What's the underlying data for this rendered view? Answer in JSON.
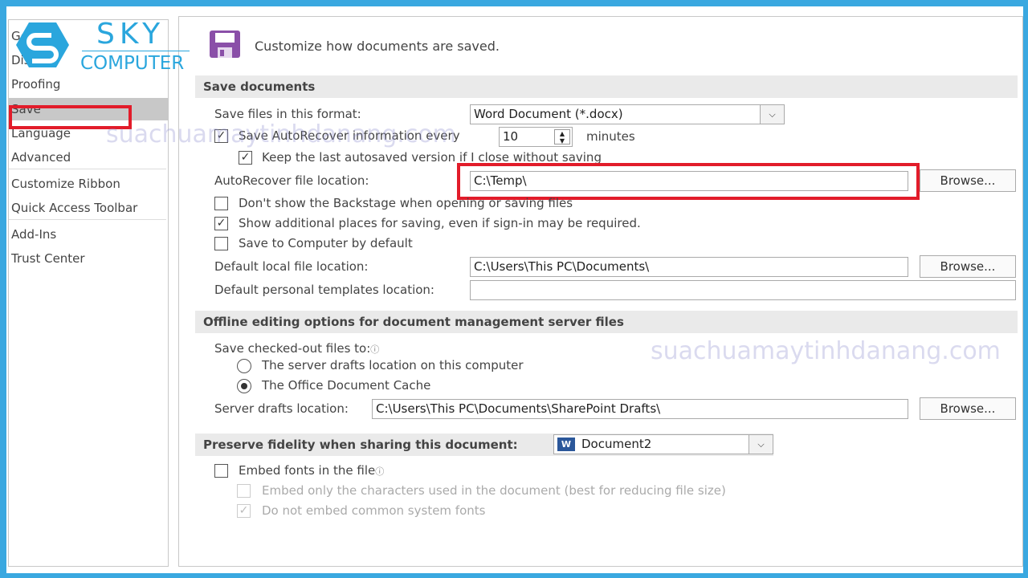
{
  "sidebar": {
    "items": [
      {
        "label": "General"
      },
      {
        "label": "Display"
      },
      {
        "label": "Proofing"
      },
      {
        "label": "Save",
        "selected": true
      },
      {
        "label": "Language"
      },
      {
        "label": "Advanced"
      },
      {
        "label": "Customize Ribbon"
      },
      {
        "label": "Quick Access Toolbar"
      },
      {
        "label": "Add-Ins"
      },
      {
        "label": "Trust Center"
      }
    ]
  },
  "header": {
    "title": "Customize how documents are saved.",
    "icon": "floppy-disk-icon"
  },
  "save_documents": {
    "heading": "Save documents",
    "format_label": "Save files in this format:",
    "format_value": "Word Document (*.docx)",
    "autorecover_label": "Save AutoRecover information every",
    "autorecover_checked": true,
    "autorecover_minutes": "10",
    "minutes_label": "minutes",
    "keep_label": "Keep the last autosaved version if I close without saving",
    "keep_checked": true,
    "location_label": "AutoRecover file location:",
    "location_value": "C:\\Temp\\",
    "browse": "Browse...",
    "backstage_label": "Don't show the Backstage when opening or saving files",
    "backstage_checked": false,
    "additional_label": "Show additional places for saving, even if sign-in may be required.",
    "additional_checked": true,
    "computer_label": "Save to Computer by default",
    "computer_checked": false,
    "local_label": "Default local file location:",
    "local_value": "C:\\Users\\This PC\\Documents\\",
    "templates_label": "Default personal templates location:",
    "templates_value": ""
  },
  "offline": {
    "heading": "Offline editing options for document management server files",
    "checked_out_label": "Save checked-out files to:",
    "radio1": "The server drafts location on this computer",
    "radio2": "The Office Document Cache",
    "selected": 2,
    "drafts_label": "Server drafts location:",
    "drafts_value": "C:\\Users\\This PC\\Documents\\SharePoint Drafts\\",
    "browse": "Browse..."
  },
  "fidelity": {
    "heading": "Preserve fidelity when sharing this document:",
    "document": "Document2",
    "embed_label": "Embed fonts in the file",
    "embed_checked": false,
    "only_chars_label": "Embed only the characters used in the document (best for reducing file size)",
    "no_common_label": "Do not embed common system fonts",
    "no_common_checked": true
  },
  "watermark": {
    "logo_top": "SKY",
    "logo_bottom": "COMPUTER",
    "site": "suachuamaytinhdanang.com"
  },
  "colors": {
    "frame": "#3aa8e0",
    "highlight": "#e21c2a",
    "icon": "#8a4fa8",
    "logo": "#2aa6dd"
  }
}
